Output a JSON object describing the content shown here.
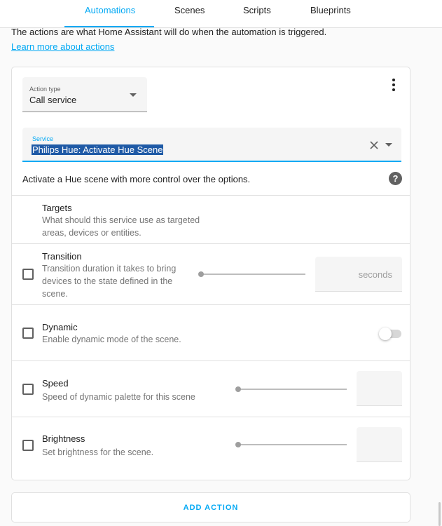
{
  "tabs": [
    {
      "label": "Automations",
      "active": true
    },
    {
      "label": "Scenes",
      "active": false
    },
    {
      "label": "Scripts",
      "active": false
    },
    {
      "label": "Blueprints",
      "active": false
    }
  ],
  "intro": {
    "text": "The actions are what Home Assistant will do when the automation is triggered.",
    "link": "Learn more about actions"
  },
  "action": {
    "type_label": "Action type",
    "type_value": "Call service",
    "service_label": "Service",
    "service_value": "Philips Hue: Activate Hue Scene",
    "description": "Activate a Hue scene with more control over the options."
  },
  "fields": {
    "targets": {
      "title": "Targets",
      "desc": "What should this service use as targeted areas, devices or entities."
    },
    "transition": {
      "title": "Transition",
      "desc": "Transition duration it takes to bring devices to the state defined in the scene.",
      "unit": "seconds",
      "value": 0
    },
    "dynamic": {
      "title": "Dynamic",
      "desc": "Enable dynamic mode of the scene.",
      "enabled": false
    },
    "speed": {
      "title": "Speed",
      "desc": "Speed of dynamic palette for this scene",
      "value": 0
    },
    "brightness": {
      "title": "Brightness",
      "desc": "Set brightness for the scene.",
      "value": 0
    }
  },
  "footer": {
    "add_action": "ADD ACTION"
  },
  "colors": {
    "accent": "#03a9f4",
    "selection": "#1f5aa6",
    "text": "#212121",
    "secondary": "#757575"
  },
  "icons": [
    "more-vert-icon",
    "dropdown-arrow-icon",
    "close-icon",
    "help-icon",
    "checkbox-icon"
  ]
}
